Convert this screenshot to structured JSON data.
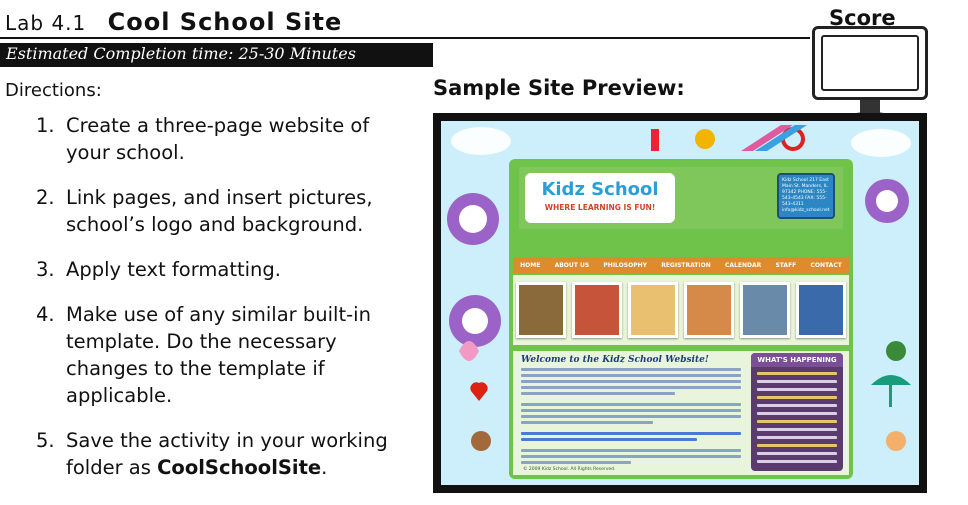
{
  "header": {
    "lab_number": "Lab 4.1",
    "title": "Cool School Site",
    "score_label": "Score"
  },
  "estimated_time": "Estimated Completion time: 25-30 Minutes",
  "directions_label": "Directions:",
  "steps": [
    {
      "num": "1.",
      "text": "Create a three-page website of your school."
    },
    {
      "num": "2.",
      "text": "Link pages, and insert pictures, school’s logo and background."
    },
    {
      "num": "3.",
      "text": "Apply text formatting."
    },
    {
      "num": "4.",
      "text": "Make use of any similar built-in template. Do the necessary changes to the template if applicable."
    },
    {
      "num": "5.",
      "text_before": "Save the activity in your working folder as ",
      "bold": "CoolSchoolSite",
      "text_after": "."
    }
  ],
  "preview": {
    "title": "Sample Site Preview:",
    "site_brand": "Kidz School",
    "site_tagline": "WHERE LEARNING IS FUN!",
    "address": "Kidz School 217 East Main St. Manders, IL 97342 PHONE: 555-543-4543 FAX: 555-543-4311 info@kidz_school.net",
    "nav": [
      "HOME",
      "ABOUT US",
      "PHILOSOPHY",
      "REGISTRATION",
      "CALENDAR",
      "STAFF",
      "CONTACT"
    ],
    "welcome": "Welcome to the Kidz School Website!",
    "sidebar_head": "WHAT'S HAPPENING",
    "footer": "© 2009 Kidz School. All Rights Reserved."
  },
  "colors": {
    "bar": "#111111",
    "site_green": "#6fc24a",
    "nav_orange": "#e08a2e",
    "brand_blue": "#2a9fd6",
    "sidebar_purple": "#5b3a6e"
  }
}
